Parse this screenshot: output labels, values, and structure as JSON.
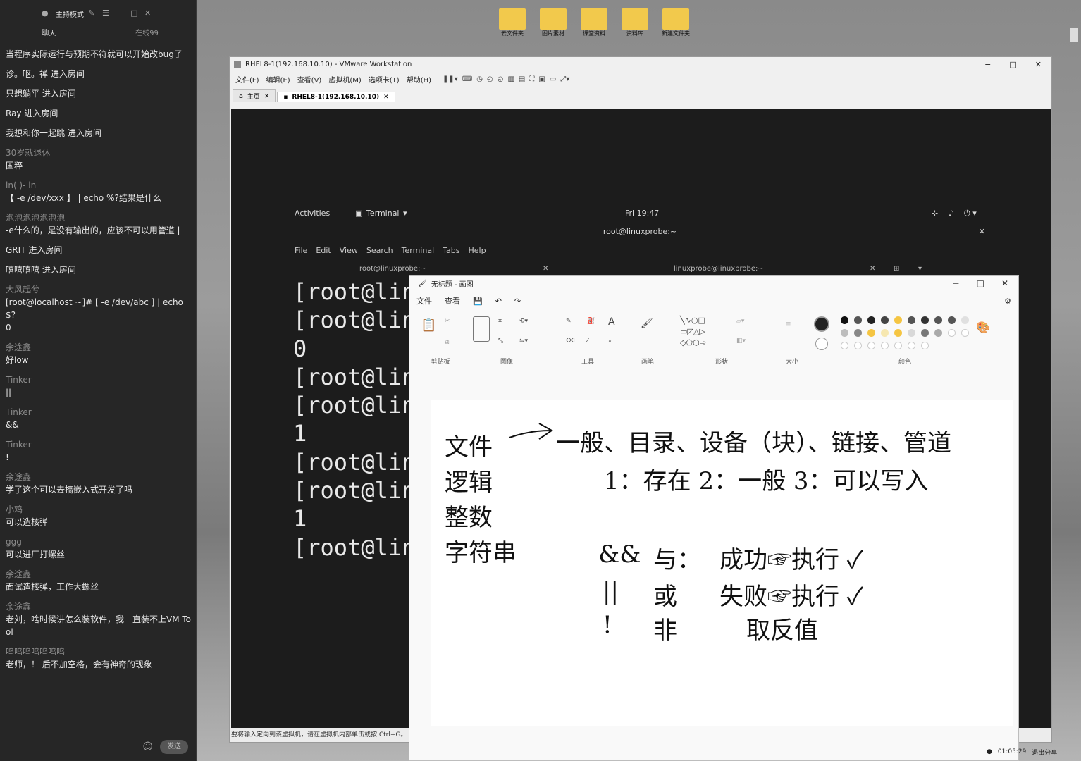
{
  "chat": {
    "mode_label": "主持模式",
    "tabs": [
      "聊天",
      "在线99"
    ],
    "messages": [
      {
        "user": "",
        "text": "当程序实际运行与预期不符就可以开始改bug了"
      },
      {
        "user": "",
        "text": "诊。呕。禅 进入房间"
      },
      {
        "user": "",
        "text": "只想躺平 进入房间"
      },
      {
        "user": "",
        "text": "Ray 进入房间"
      },
      {
        "user": "",
        "text": "我想和你一起跳 进入房间"
      },
      {
        "user": "30岁就退休",
        "text": "国粹"
      },
      {
        "user": "ln(   )-    ln",
        "text": "【 -e /dev/xxx 】 | echo %?结果是什么"
      },
      {
        "user": "泡泡泡泡泡泡泡",
        "text": "-e什么的，是没有输出的，应该不可以用管道 |"
      },
      {
        "user": "",
        "text": "GRIT 进入房间"
      },
      {
        "user": "",
        "text": "嘻嘻嘻嘻 进入房间"
      },
      {
        "user": "大风起兮",
        "text": "[root@localhost ~]# [ -e /dev/abc ] | echo $?\n0"
      },
      {
        "user": "余途鑫",
        "text": "好low"
      },
      {
        "user": "Tinker",
        "text": "||"
      },
      {
        "user": "Tinker",
        "text": "&&"
      },
      {
        "user": "Tinker",
        "text": "!"
      },
      {
        "user": "余途鑫",
        "text": "学了这个可以去搞嵌入式开发了吗"
      },
      {
        "user": "小鸡",
        "text": "可以造核弹"
      },
      {
        "user": "ggg",
        "text": "可以进厂打螺丝"
      },
      {
        "user": "余途鑫",
        "text": "面试造核弹，工作大螺丝"
      },
      {
        "user": "余途鑫",
        "text": "老刘，啥时候讲怎么装软件，我一直装不上VM Tool"
      },
      {
        "user": "呜呜呜呜呜呜呜",
        "text": "老师，！ 后不加空格，会有神奇的现象"
      }
    ],
    "send_label": "发送"
  },
  "desktop_icons": [
    "云文件夹",
    "图片素材",
    "课堂资料",
    "资料库",
    "新建文件夹"
  ],
  "vmware": {
    "title": "RHEL8-1(192.168.10.10) - VMware Workstation",
    "menu": [
      "文件(F)",
      "编辑(E)",
      "查看(V)",
      "虚拟机(M)",
      "选项卡(T)",
      "帮助(H)"
    ],
    "tabs": [
      "主页",
      "RHEL8-1(192.168.10.10)"
    ],
    "status": "要将输入定向到该虚拟机，请在虚拟机内部单击或按 Ctrl+G。"
  },
  "gnome": {
    "activities": "Activities",
    "app": "Terminal",
    "clock": "Fri 19:47",
    "window_title": "root@linuxprobe:~",
    "menu": [
      "File",
      "Edit",
      "View",
      "Search",
      "Terminal",
      "Tabs",
      "Help"
    ],
    "tab1": "root@linuxprobe:~",
    "tab2": "linuxprobe@linuxprobe:~",
    "terminal_lines": [
      "[root@lin",
      "[root@lin",
      "0",
      "[root@lin",
      "[root@lin",
      "1",
      "[root@lin",
      "[root@lin",
      "1",
      "[root@lin"
    ]
  },
  "paint": {
    "title": "无标题 - 画图",
    "menu": [
      "文件",
      "查看"
    ],
    "groups": [
      "剪贴板",
      "图像",
      "工具",
      "画笔",
      "形状",
      "大小",
      "颜色"
    ],
    "colors": [
      "#111111",
      "#555555",
      "#222222",
      "#444444",
      "#f5c542",
      "#555555",
      "#333333",
      "#555555",
      "#555555",
      "#e0e0e0",
      "#bdbdbd",
      "#888888",
      "#f5c542",
      "#f6e7b0",
      "#f5c542",
      "#d9d9d9",
      "#777777",
      "#aaaaaa"
    ],
    "notes": {
      "r1a": "文件",
      "r1b": "一般、目录、设备（块）、链接、管道",
      "r2a": "逻辑",
      "r2b": "1：存在  2：一般  3：可以写入",
      "r3a": "整数",
      "r4a": "字符串",
      "r4b": "&&",
      "r4c": "与：",
      "r4d": "成功☞执行 ✓",
      "r5b": "||",
      "r5c": "或",
      "r5d": "失败☞执行 ✓",
      "r6b": "!",
      "r6c": "非",
      "r6d": "取反值"
    }
  },
  "taskbar": {
    "time": "01:05:29",
    "exit_share": "退出分享"
  }
}
